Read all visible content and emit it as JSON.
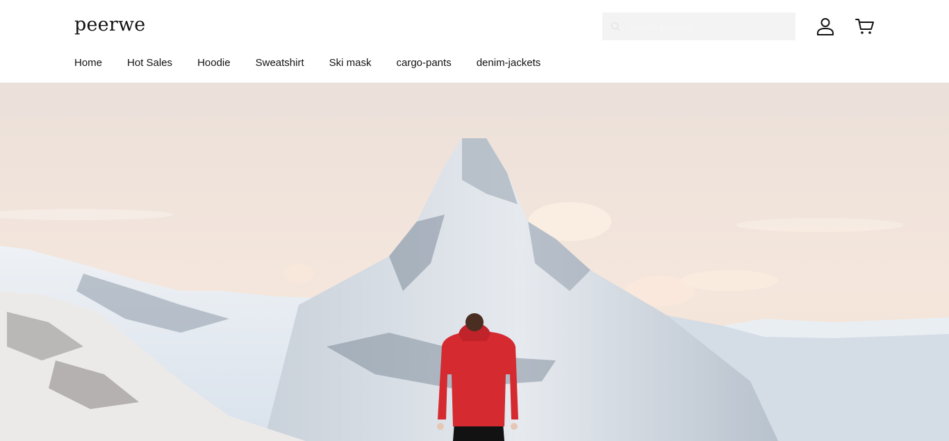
{
  "brand": {
    "name": "peerwe"
  },
  "search": {
    "placeholder": "Search products"
  },
  "icons": {
    "search": "search-icon",
    "account": "user-icon",
    "cart": "cart-icon"
  },
  "nav": {
    "items": [
      {
        "label": "Home"
      },
      {
        "label": "Hot Sales"
      },
      {
        "label": "Hoodie"
      },
      {
        "label": "Sweatshirt"
      },
      {
        "label": "Ski mask"
      },
      {
        "label": "cargo-pants"
      },
      {
        "label": "denim-jackets"
      }
    ]
  },
  "hero": {
    "image": "Snowy mountain peak with a person in a red jacket"
  },
  "colors": {
    "text": "#121212",
    "search_bg": "#f3f3f3",
    "jacket": "#d42a30"
  }
}
